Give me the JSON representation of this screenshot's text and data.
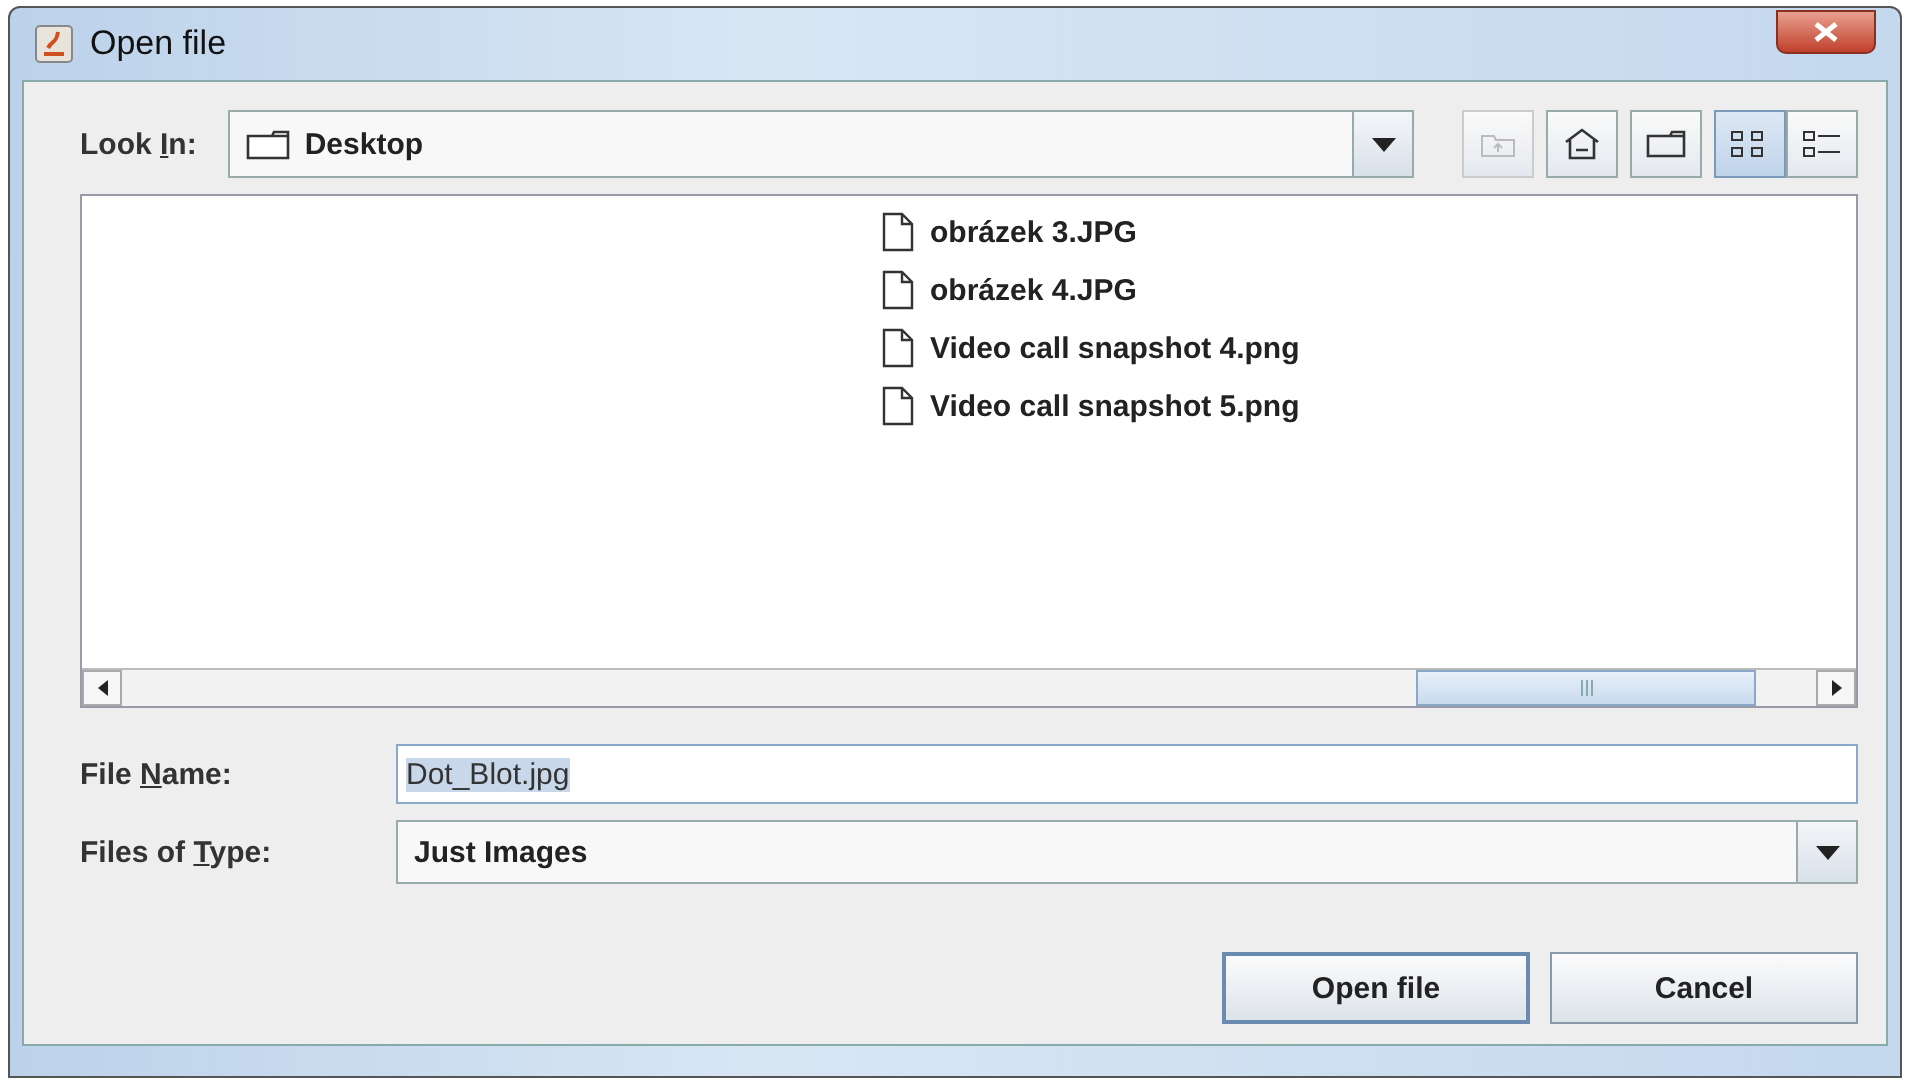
{
  "window": {
    "title": "Open file"
  },
  "look_in": {
    "label": {
      "before": "Look ",
      "underlined": "I",
      "after": "n:"
    },
    "value": "Desktop"
  },
  "toolbar": [
    {
      "kind": "up",
      "disabled": true,
      "selected": false
    },
    {
      "kind": "home",
      "disabled": false,
      "selected": false
    },
    {
      "kind": "new-folder",
      "disabled": false,
      "selected": false
    },
    {
      "kind": "list",
      "disabled": false,
      "selected": true
    },
    {
      "kind": "details",
      "disabled": false,
      "selected": false
    }
  ],
  "files": [
    {
      "name": "obrázek 3.JPG"
    },
    {
      "name": "obrázek 4.JPG"
    },
    {
      "name": "Video call snapshot 4.png"
    },
    {
      "name": "Video call snapshot 5.png"
    }
  ],
  "file_name": {
    "label": {
      "before": "File ",
      "underlined": "N",
      "after": "ame:"
    },
    "value": "Dot_Blot.jpg",
    "text_selected": true
  },
  "file_type": {
    "label": {
      "before": "Files of ",
      "underlined": "T",
      "after": "ype:"
    },
    "value": "Just Images"
  },
  "buttons": [
    {
      "label": "Open file",
      "default": true
    },
    {
      "label": "Cancel",
      "default": false
    }
  ]
}
